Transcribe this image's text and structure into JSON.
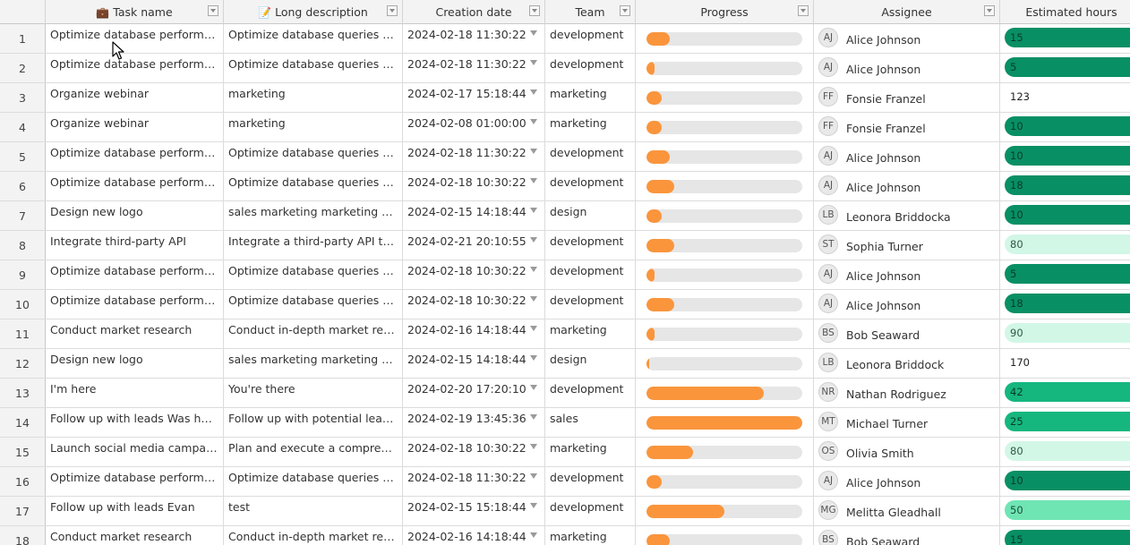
{
  "columns": [
    {
      "key": "rownum",
      "label": ""
    },
    {
      "key": "task_name",
      "label": "Task name",
      "icon": "briefcase-icon",
      "icon_glyph": "💼",
      "filter": true
    },
    {
      "key": "long_description",
      "label": "Long description",
      "icon": "memo-icon",
      "icon_glyph": "📝",
      "filter": true
    },
    {
      "key": "creation_date",
      "label": "Creation date",
      "filter": true
    },
    {
      "key": "team",
      "label": "Team",
      "filter": true
    },
    {
      "key": "progress",
      "label": "Progress",
      "filter": true
    },
    {
      "key": "assignee",
      "label": "Assignee",
      "filter": true
    },
    {
      "key": "estimated_hours",
      "label": "Estimated hours",
      "filter": false
    }
  ],
  "colors": {
    "progress_fill": "#fa953c",
    "progress_track": "#e6e6e6",
    "hours_dark": "#098f64",
    "hours_medium": "#16b67f",
    "hours_mint": "#6fe5b4",
    "hours_pale": "#d2f7e6"
  },
  "rows": [
    {
      "num": "1",
      "task": "Optimize database performance",
      "desc": "Optimize database queries and…",
      "date": "2024-02-18 11:30:22",
      "team": "development",
      "progress": 0.15,
      "initials": "AJ",
      "assignee": "Alice Johnson",
      "hours": "15",
      "hours_style": "dark"
    },
    {
      "num": "2",
      "task": "Optimize database performance",
      "desc": "Optimize database queries and…",
      "date": "2024-02-18 11:30:22",
      "team": "development",
      "progress": 0.05,
      "initials": "AJ",
      "assignee": "Alice Johnson",
      "hours": "5",
      "hours_style": "dark"
    },
    {
      "num": "3",
      "task": "Organize webinar",
      "desc": "marketing",
      "date": "2024-02-17 15:18:44",
      "team": "marketing",
      "progress": 0.1,
      "initials": "FF",
      "assignee": "Fonsie Franzel",
      "hours": "123",
      "hours_style": "none"
    },
    {
      "num": "4",
      "task": "Organize webinar",
      "desc": "marketing",
      "date": "2024-02-08 01:00:00",
      "team": "marketing",
      "progress": 0.1,
      "initials": "FF",
      "assignee": "Fonsie Franzel",
      "hours": "10",
      "hours_style": "dark"
    },
    {
      "num": "5",
      "task": "Optimize database performance",
      "desc": "Optimize database queries and…",
      "date": "2024-02-18 11:30:22",
      "team": "development",
      "progress": 0.15,
      "initials": "AJ",
      "assignee": "Alice Johnson",
      "hours": "10",
      "hours_style": "dark"
    },
    {
      "num": "6",
      "task": "Optimize database performance",
      "desc": "Optimize database queries and…",
      "date": "2024-02-18 10:30:22",
      "team": "development",
      "progress": 0.18,
      "initials": "AJ",
      "assignee": "Alice Johnson",
      "hours": "18",
      "hours_style": "dark"
    },
    {
      "num": "7",
      "task": "Design new logo",
      "desc": "sales marketing marketing mar…",
      "date": "2024-02-15 14:18:44",
      "team": "design",
      "progress": 0.1,
      "initials": "LB",
      "assignee": "Leonora Briddocka",
      "hours": "10",
      "hours_style": "dark"
    },
    {
      "num": "8",
      "task": "Integrate third-party API",
      "desc": "Integrate a third-party API to e…",
      "date": "2024-02-21 20:10:55",
      "team": "development",
      "progress": 0.18,
      "initials": "ST",
      "assignee": "Sophia Turner",
      "hours": "80",
      "hours_style": "pale"
    },
    {
      "num": "9",
      "task": "Optimize database performance",
      "desc": "Optimize database queries and…",
      "date": "2024-02-18 10:30:22",
      "team": "development",
      "progress": 0.05,
      "initials": "AJ",
      "assignee": "Alice Johnson",
      "hours": "5",
      "hours_style": "dark"
    },
    {
      "num": "10",
      "task": "Optimize database performance",
      "desc": "Optimize database queries and…",
      "date": "2024-02-18 10:30:22",
      "team": "development",
      "progress": 0.18,
      "initials": "AJ",
      "assignee": "Alice Johnson",
      "hours": "18",
      "hours_style": "dark"
    },
    {
      "num": "11",
      "task": "Conduct market research",
      "desc": "Conduct in-depth market resea…",
      "date": "2024-02-16 14:18:44",
      "team": "marketing",
      "progress": 0.05,
      "initials": "BS",
      "assignee": "Bob Seaward",
      "hours": "90",
      "hours_style": "pale"
    },
    {
      "num": "12",
      "task": "Design new logo",
      "desc": "sales marketing marketing mar…",
      "date": "2024-02-15 14:18:44",
      "team": "design",
      "progress": 0.02,
      "initials": "LB",
      "assignee": "Leonora Briddock",
      "hours": "170",
      "hours_style": "none"
    },
    {
      "num": "13",
      "task": "I'm here",
      "desc": "You're there",
      "date": "2024-02-20 17:20:10",
      "team": "development",
      "progress": 0.75,
      "initials": "NR",
      "assignee": "Nathan Rodriguez",
      "hours": "42",
      "hours_style": "medium"
    },
    {
      "num": "14",
      "task": "Follow up with leads Was here",
      "desc": "Follow up with potential leads t…",
      "date": "2024-02-19 13:45:36",
      "team": "sales",
      "progress": 1.0,
      "initials": "MT",
      "assignee": "Michael Turner",
      "hours": "25",
      "hours_style": "medium"
    },
    {
      "num": "15",
      "task": "Launch social media campaign",
      "desc": "Plan and execute a comprehen…",
      "date": "2024-02-18 10:30:22",
      "team": "marketing",
      "progress": 0.3,
      "initials": "OS",
      "assignee": "Olivia Smith",
      "hours": "80",
      "hours_style": "pale"
    },
    {
      "num": "16",
      "task": "Optimize database performance",
      "desc": "Optimize database queries and…",
      "date": "2024-02-18 11:30:22",
      "team": "development",
      "progress": 0.1,
      "initials": "AJ",
      "assignee": "Alice Johnson",
      "hours": "10",
      "hours_style": "dark"
    },
    {
      "num": "17",
      "task": "Follow up with leads Evan",
      "desc": "test",
      "date": "2024-02-15 15:18:44",
      "team": "development",
      "progress": 0.5,
      "initials": "MG",
      "assignee": "Melitta Gleadhall",
      "hours": "50",
      "hours_style": "mint"
    },
    {
      "num": "18",
      "task": "Conduct market research",
      "desc": "Conduct in-depth market resea…",
      "date": "2024-02-16 14:18:44",
      "team": "marketing",
      "progress": 0.15,
      "initials": "BS",
      "assignee": "Bob Seaward",
      "hours": "15",
      "hours_style": "dark"
    }
  ]
}
